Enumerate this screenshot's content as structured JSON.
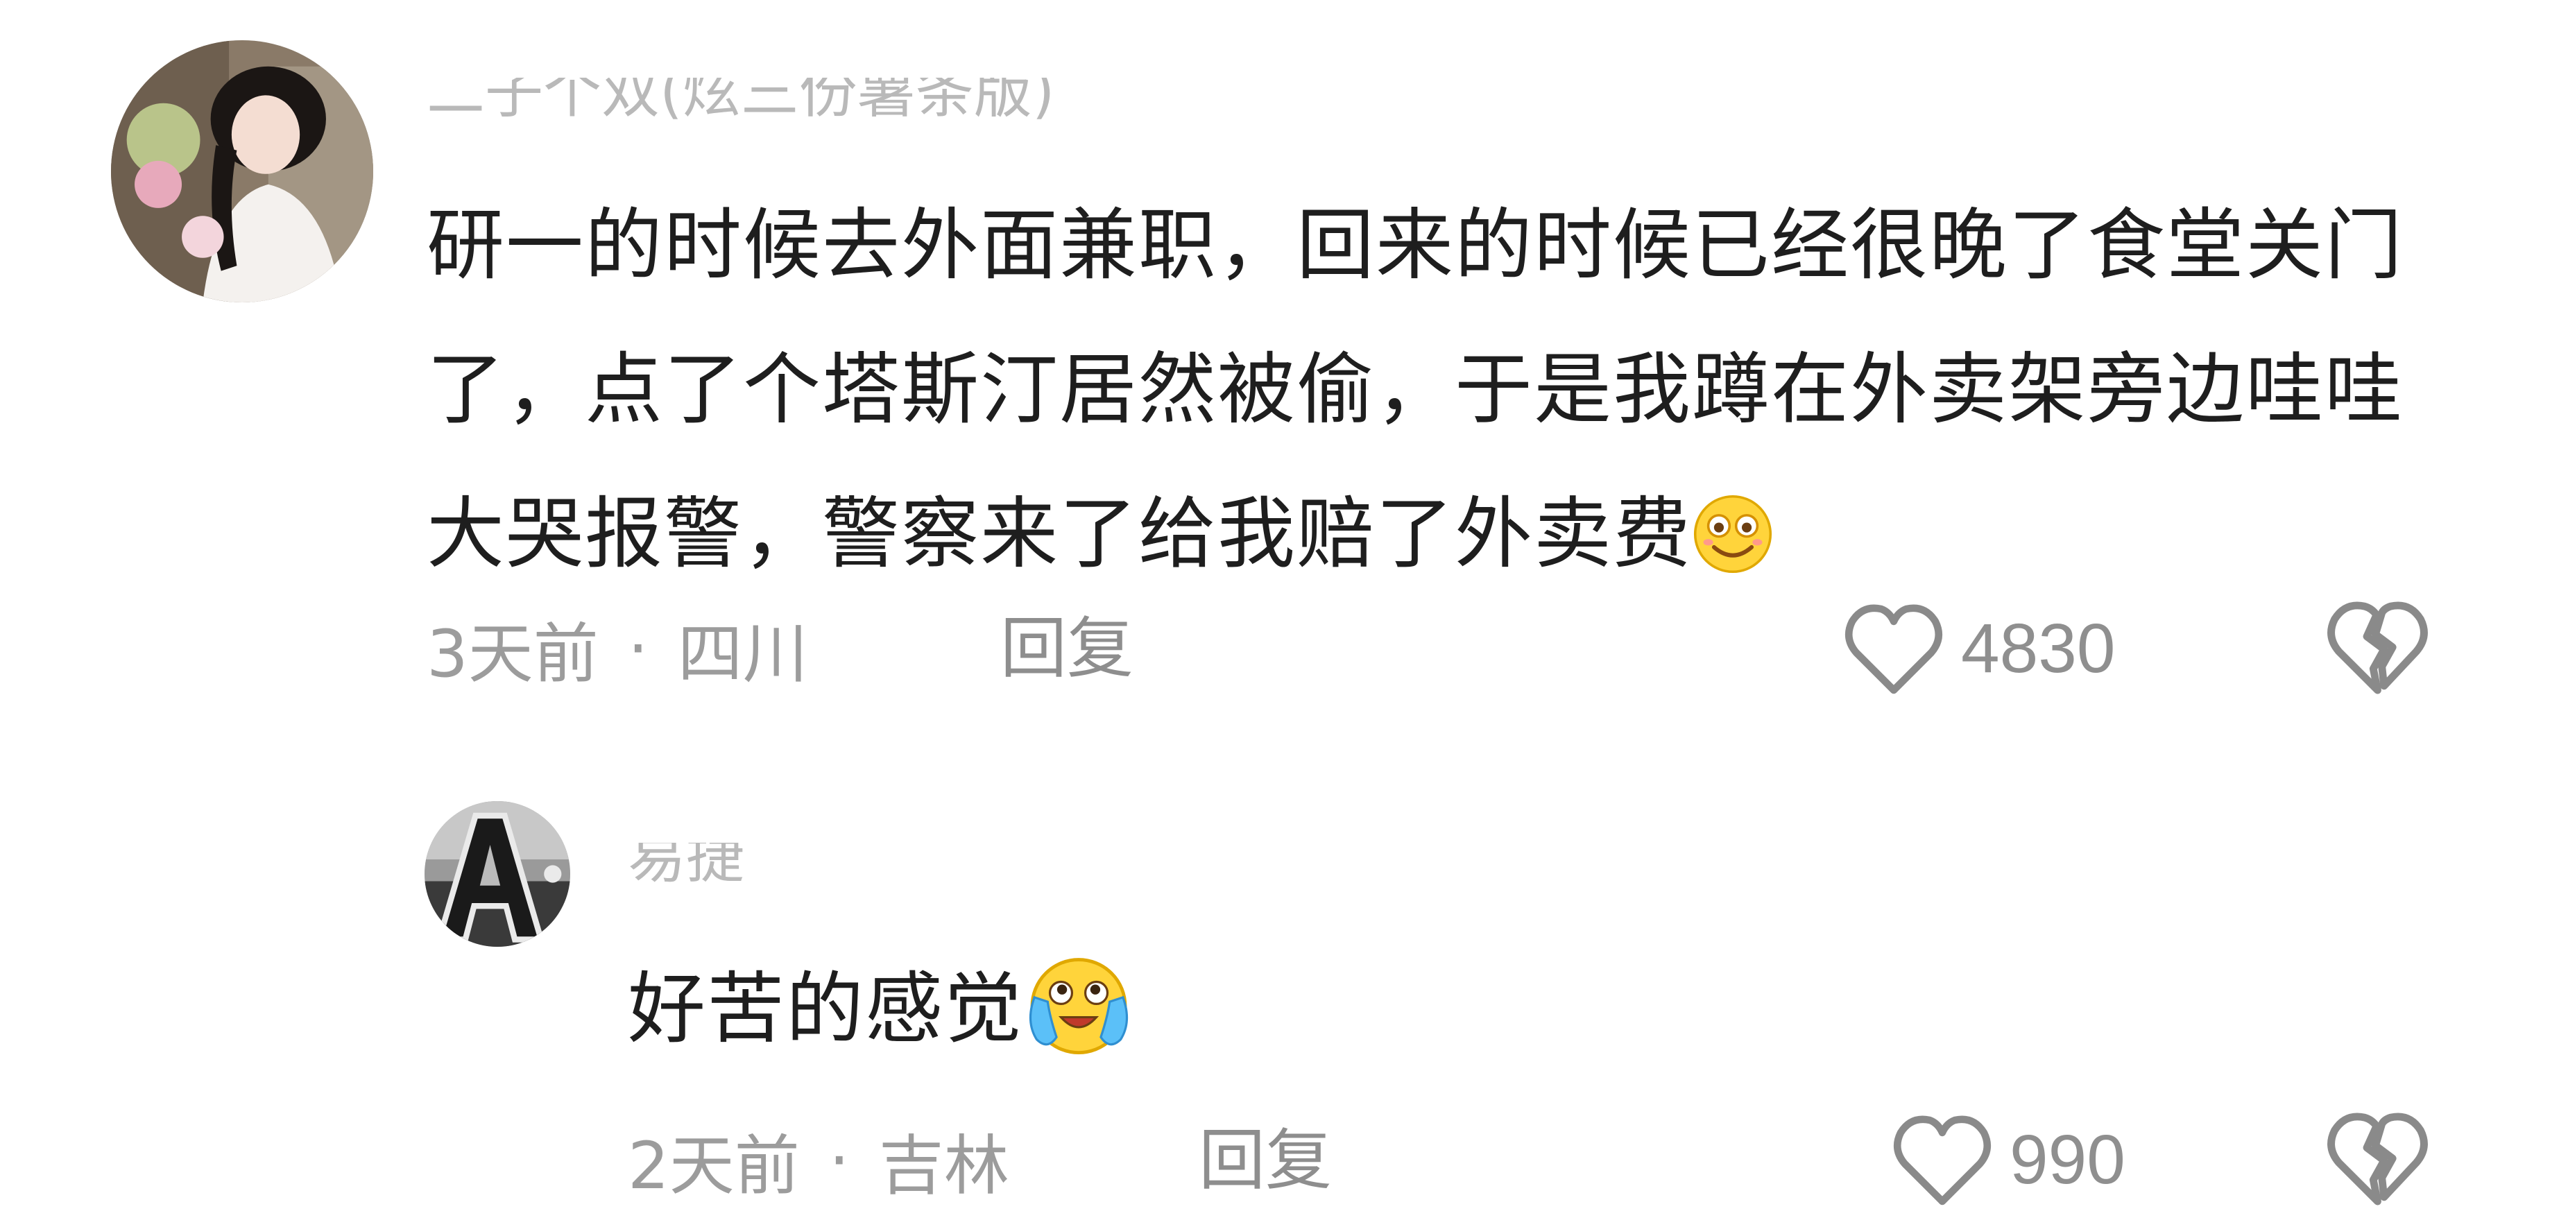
{
  "comments": [
    {
      "username": "二子个双(炫三份薯条版)",
      "text": "研一的时候去外面兼职，回来的时候已经很晚了食堂关门了，点了个塔斯汀居然被偷，于是我蹲在外卖架旁边哇哇大哭报警，警察来了给我赔了外卖费",
      "emoji": "dizzy-smile-emoji",
      "time": "3天前",
      "separator": "·",
      "location": "四川",
      "reply_label": "回复",
      "like_count": "4830"
    },
    {
      "username": "易捷",
      "text": "好苦的感觉",
      "emoji": "crying-laughing-emoji",
      "time": "2天前",
      "separator": "·",
      "location": "吉林",
      "reply_label": "回复",
      "like_count": "990"
    }
  ],
  "icons": {
    "like": "heart-outline-icon",
    "dislike": "broken-heart-outline-icon"
  },
  "colors": {
    "text": "#1e1e1e",
    "meta": "#9c9c9c",
    "icon": "#8a8a8a",
    "emoji_yellow": "#ffd43b"
  }
}
